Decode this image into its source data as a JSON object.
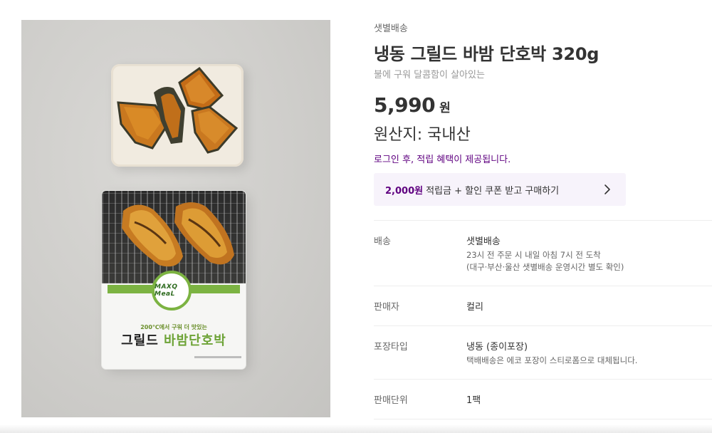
{
  "product": {
    "image_alt": "냉동 그릴드 바밤 단호박 320g",
    "package": {
      "logo": "MAXQ MeaL",
      "tagline": "200℃에서 구워 더 맛있는",
      "name_prefix": "그릴드 ",
      "name_accent": "바밤단호박"
    }
  },
  "info": {
    "delivery_tag": "샛별배송",
    "title": "냉동 그릴드 바밤 단호박 320g",
    "subtitle": "불에 구워 달콤함이 살아있는",
    "price": "5,990",
    "currency": "원",
    "origin": "원산지: 국내산",
    "login_notice": "로그인 후, 적립 혜택이 제공됩니다.",
    "coupon": {
      "amount": "2,000원",
      "text": "적립금 + 할인 쿠폰 받고 구매하기",
      "icon": "chevron-right-icon"
    }
  },
  "details": [
    {
      "label": "배송",
      "value": "샛별배송",
      "notes": [
        "23시 전 주문 시 내일 아침 7시 전 도착",
        "(대구·부산·울산 샛별배송 운영시간 별도 확인)"
      ]
    },
    {
      "label": "판매자",
      "value": "컬리",
      "notes": []
    },
    {
      "label": "포장타입",
      "value": "냉동 (종이포장)",
      "notes": [
        "택배배송은 에코 포장이 스티로폼으로 대체됩니다."
      ]
    },
    {
      "label": "판매단위",
      "value": "1팩",
      "notes": []
    }
  ],
  "colors": {
    "accent": "#5f0080",
    "banner_bg": "#f7f3fb",
    "divider": "#eeeeee"
  }
}
